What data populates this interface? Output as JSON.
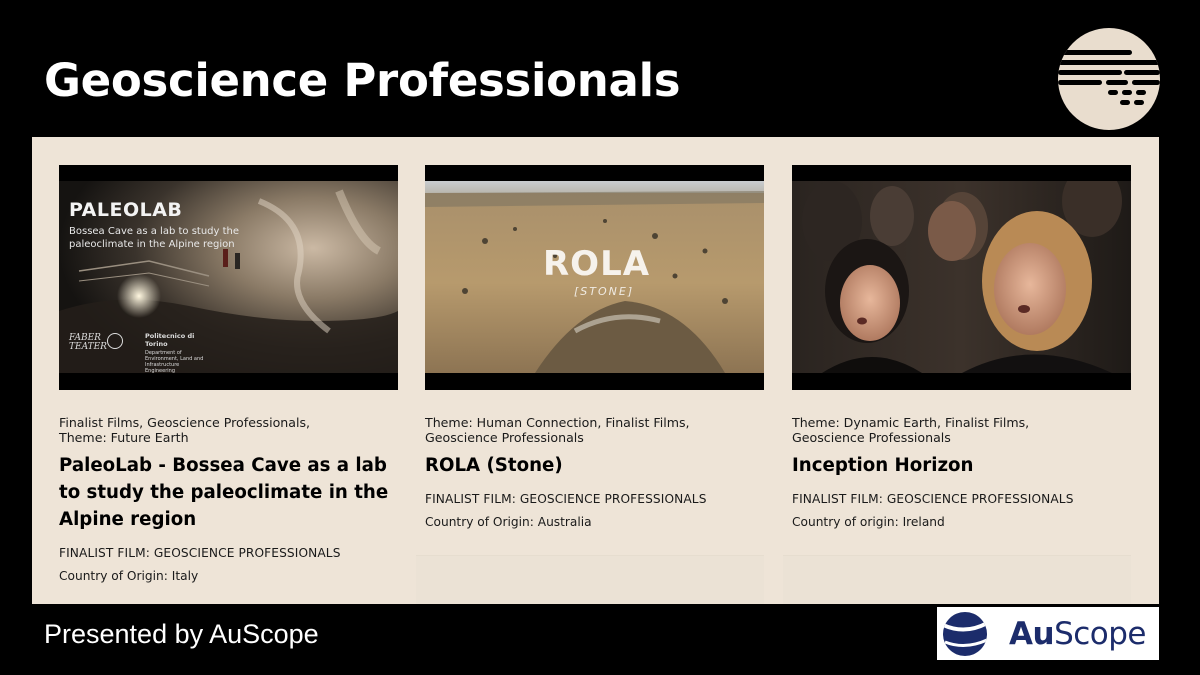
{
  "slide": {
    "title": "Geoscience Professionals",
    "footer": "Presented by AuScope"
  },
  "brand": {
    "name_a": "Au",
    "name_b": "Scope",
    "color": "#1c2c6b"
  },
  "colors": {
    "panel": "#eee4d7",
    "background": "#000000",
    "logo_circle": "#e9ddce"
  },
  "cards": [
    {
      "meta": "Finalist Films, Geoscience Professionals, Theme: Future Earth",
      "title": "PaleoLab - Bossea Cave as a lab to study the paleoclimate in the Alpine region",
      "label": "FINALIST FILM: GEOSCIENCE PROFESSIONALS",
      "origin": "Country of Origin: Italy",
      "thumb": {
        "title": "PALEOLAB",
        "subtitle": "Bossea Cave as a lab to study the paleoclimate in the Alpine region",
        "brand": "FABER TEATER",
        "institution": "Politecnico di Torino",
        "department": "Department of Environment, Land and Infrastructure Engineering"
      }
    },
    {
      "meta": "Theme: Human Connection, Finalist Films, Geoscience Professionals",
      "title": "ROLA (Stone)",
      "label": "FINALIST FILM: GEOSCIENCE PROFESSIONALS",
      "origin": "Country of Origin: Australia",
      "thumb": {
        "title": "ROLA",
        "subtitle": "[STONE]"
      }
    },
    {
      "meta": "Theme: Dynamic Earth, Finalist Films, Geoscience Professionals",
      "title": "Inception Horizon",
      "label": "FINALIST FILM: GEOSCIENCE PROFESSIONALS",
      "origin": "Country of origin: Ireland"
    }
  ]
}
